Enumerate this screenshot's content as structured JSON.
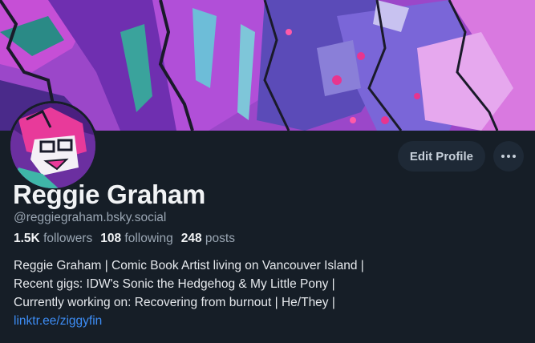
{
  "profile": {
    "display_name": "Reggie Graham",
    "handle": "@reggiegraham.bsky.social",
    "stats": {
      "followers_count": "1.5K",
      "followers_label": "followers",
      "following_count": "108",
      "following_label": "following",
      "posts_count": "248",
      "posts_label": "posts"
    },
    "bio_lines": [
      "Reggie Graham | Comic Book Artist living on Vancouver Island |",
      "Recent gigs: IDW's Sonic the Hedgehog & My Little Pony |",
      "Currently working on: Recovering from burnout | He/They |"
    ],
    "link": "linktr.ee/ziggyfin"
  },
  "actions": {
    "edit_label": "Edit Profile",
    "more_icon": "ellipsis-icon"
  },
  "colors": {
    "background": "#161e27",
    "link": "#3d8df5",
    "secondary_text": "#9aa6b3",
    "button_bg": "#1e2936"
  }
}
